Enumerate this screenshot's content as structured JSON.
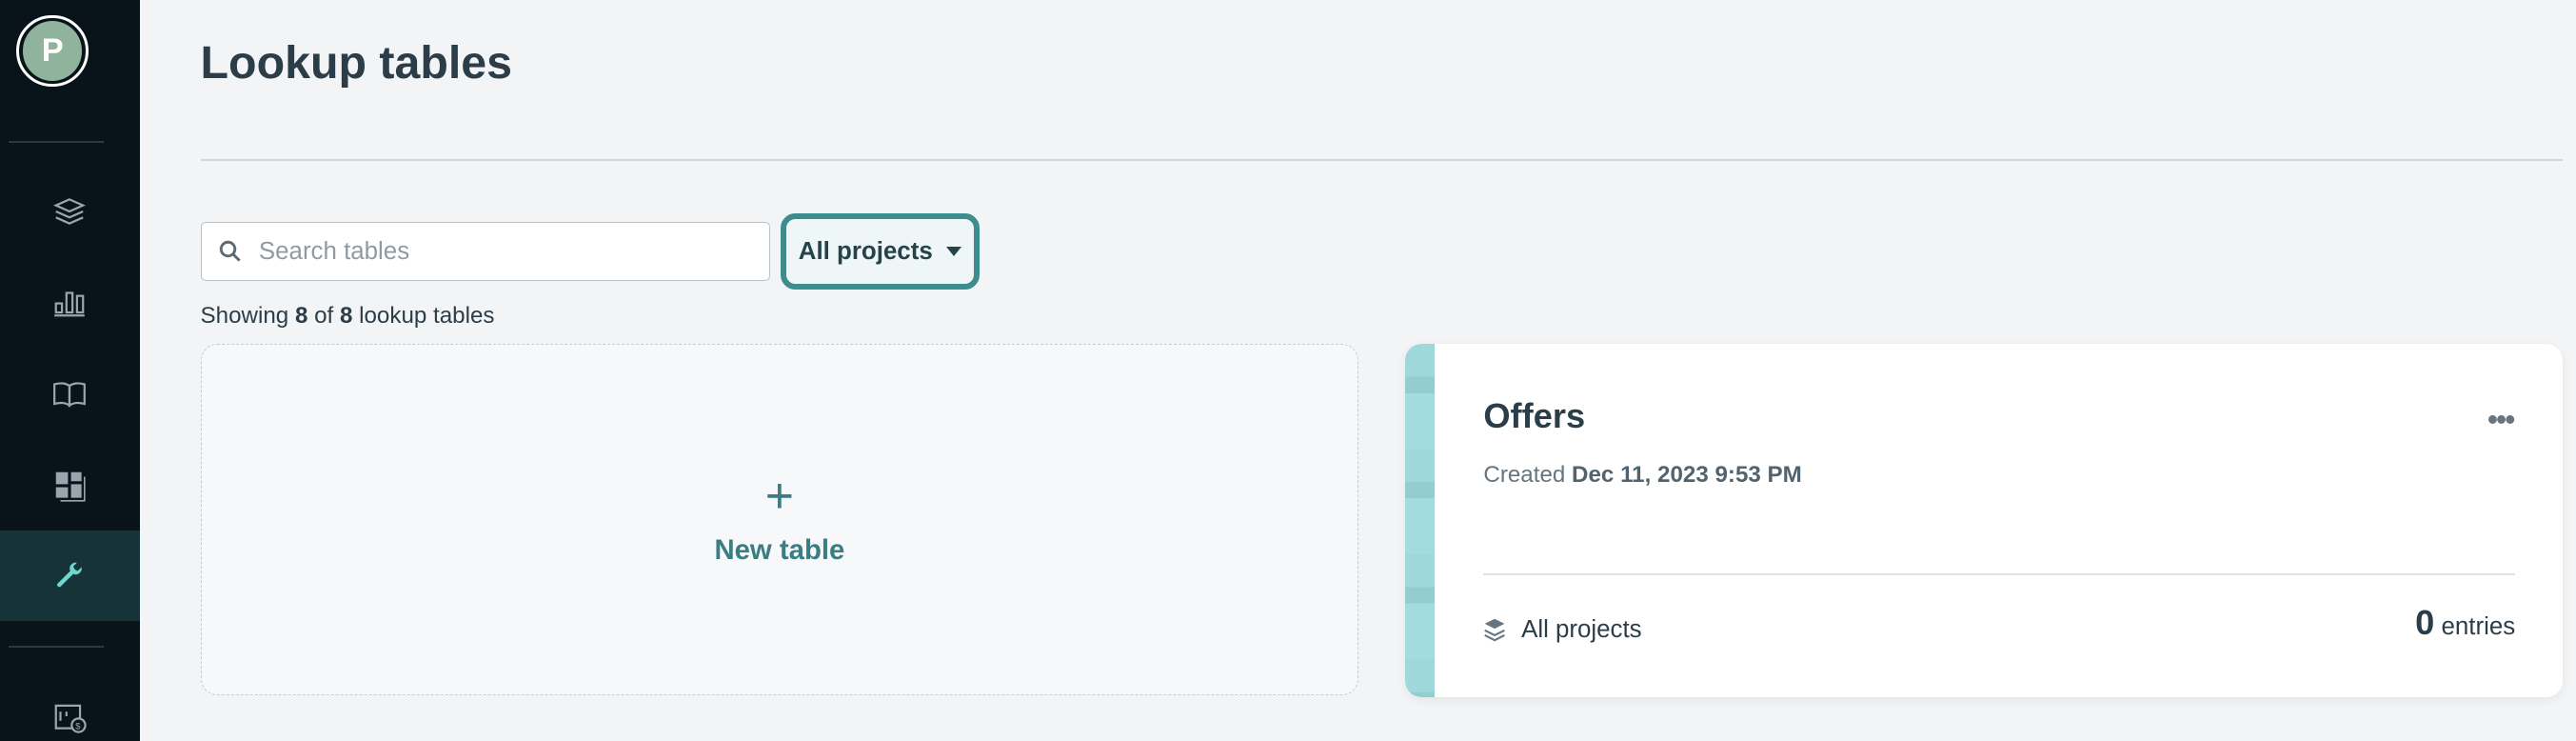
{
  "sidebar": {
    "avatar_letter": "P",
    "items": [
      {
        "icon": "layers-icon"
      },
      {
        "icon": "bar-chart-icon"
      },
      {
        "icon": "book-icon"
      },
      {
        "icon": "dashboard-icon"
      },
      {
        "icon": "wrench-icon",
        "active": true
      },
      {
        "icon": "billing-icon"
      }
    ]
  },
  "page": {
    "title": "Lookup tables"
  },
  "filters": {
    "search_placeholder": "Search tables",
    "search_value": "",
    "project_select": "All projects"
  },
  "summary": {
    "prefix": "Showing",
    "shown": "8",
    "of": "of",
    "total": "8",
    "suffix": "lookup tables"
  },
  "new_table": {
    "icon": "plus-icon",
    "label": "New table"
  },
  "tables": [
    {
      "name": "Offers",
      "created_label": "Created",
      "created": "Dec 11, 2023 9:53 PM",
      "project": "All projects",
      "entries_count": "0",
      "entries_label": "entries"
    }
  ],
  "colors": {
    "accent": "#3d8c8e",
    "sidebar_bg": "#08141a",
    "active_icon": "#6fd6cf",
    "card_strip": "#9fd8da"
  }
}
